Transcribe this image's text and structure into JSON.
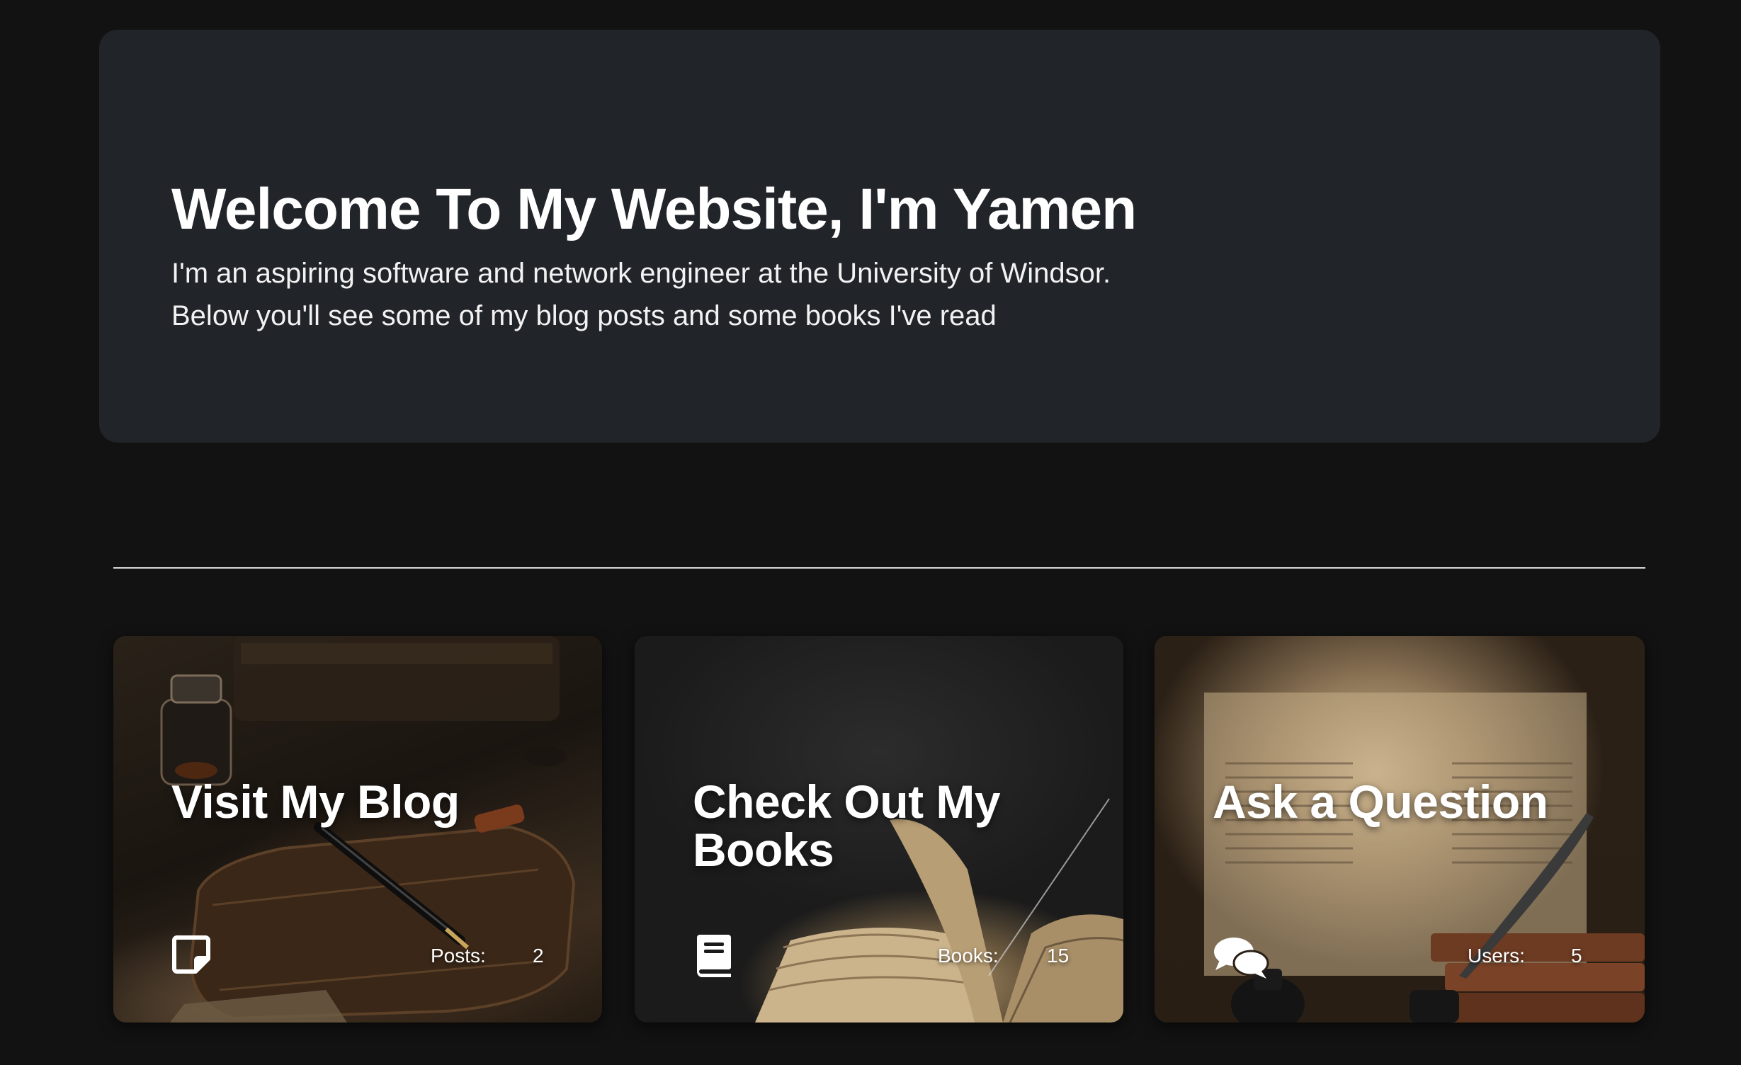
{
  "hero": {
    "title": "Welcome To My Website, I'm Yamen",
    "line1": "I'm an aspiring software and network engineer at the University of Windsor.",
    "line2": "Below you'll see some of my blog posts and some books I've read"
  },
  "cards": [
    {
      "title": "Visit My Blog",
      "icon": "sticky-note-icon",
      "stat_label": "Posts:",
      "stat_value": "2"
    },
    {
      "title": "Check Out My Books",
      "icon": "book-icon",
      "stat_label": "Books:",
      "stat_value": "15"
    },
    {
      "title": "Ask a Question",
      "icon": "comments-icon",
      "stat_label": "Users:",
      "stat_value": "5"
    }
  ],
  "colors": {
    "page_background": "#121212",
    "hero_background": "#212429",
    "text": "#ffffff",
    "divider": "#d9d9d9"
  }
}
